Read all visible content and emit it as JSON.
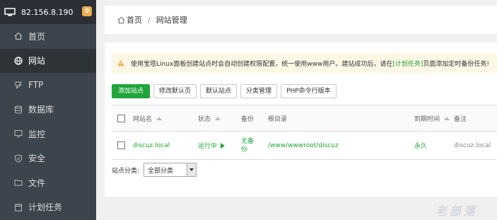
{
  "server": {
    "ip": "82.156.8.190",
    "badge": "0"
  },
  "nav": [
    {
      "label": "首页",
      "icon": "home-icon"
    },
    {
      "label": "网站",
      "icon": "globe-icon",
      "active": true
    },
    {
      "label": "FTP",
      "icon": "ftp-icon"
    },
    {
      "label": "数据库",
      "icon": "database-icon"
    },
    {
      "label": "监控",
      "icon": "monitor-icon"
    },
    {
      "label": "安全",
      "icon": "shield-icon"
    },
    {
      "label": "文件",
      "icon": "folder-icon"
    },
    {
      "label": "计划任务",
      "icon": "calendar-icon"
    }
  ],
  "breadcrumb": {
    "home": "首页",
    "sep": "/",
    "current": "网站管理"
  },
  "warning": {
    "text_before": "使用宝塔Linux面板创建站点时会自动创建权限配置，统一使用www用户。建站成功后，请在",
    "link": "[计划任务]",
    "text_after": "页面添加定时备份任务!"
  },
  "toolbar": {
    "add": "添加站点",
    "default_page": "修改默认页",
    "default_site": "默认站点",
    "category": "分类管理",
    "php_cli": "PHP命令行版本"
  },
  "table": {
    "headers": {
      "name": "网站名",
      "status": "状态",
      "backup": "备份",
      "root": "根目录",
      "expire": "到期时间",
      "note": "备注"
    },
    "rows": [
      {
        "name": "discuz.local",
        "status": "运行中",
        "backup_1": "无备",
        "backup_2": "份",
        "root": "/www/wwwroot/discuz",
        "expire": "永久",
        "note": "discuz.local"
      }
    ]
  },
  "filter": {
    "label": "站点分类:",
    "selected": "全部分类"
  },
  "watermark": "老部落",
  "colors": {
    "accent": "#20a53a",
    "sidebar": "#3c444d",
    "badge": "#f0ad4e",
    "warning_bg": "#fdf8e6"
  }
}
